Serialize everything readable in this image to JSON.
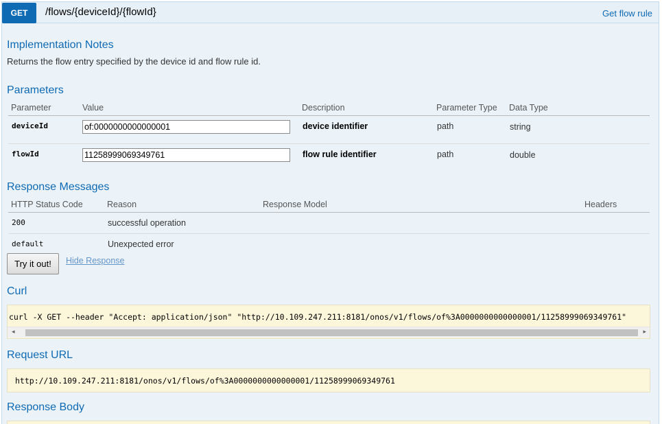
{
  "operation": {
    "method": "GET",
    "path": "/flows/{deviceId}/{flowId}",
    "summary": "Get flow rule"
  },
  "implementation_notes": {
    "title": "Implementation Notes",
    "text": "Returns the flow entry specified by the device id and flow rule id."
  },
  "parameters": {
    "title": "Parameters",
    "headers": [
      "Parameter",
      "Value",
      "Description",
      "Parameter Type",
      "Data Type"
    ],
    "rows": [
      {
        "name": "deviceId",
        "value": "of:0000000000000001",
        "description": "device identifier",
        "param_type": "path",
        "data_type": "string"
      },
      {
        "name": "flowId",
        "value": "11258999069349761",
        "description": "flow rule identifier",
        "param_type": "path",
        "data_type": "double"
      }
    ]
  },
  "response_messages": {
    "title": "Response Messages",
    "headers": [
      "HTTP Status Code",
      "Reason",
      "Response Model",
      "Headers"
    ],
    "rows": [
      {
        "code": "200",
        "reason": "successful operation"
      },
      {
        "code": "default",
        "reason": "Unexpected error"
      }
    ]
  },
  "actions": {
    "try_label": "Try it out!",
    "hide_label": "Hide Response"
  },
  "curl": {
    "title": "Curl",
    "command": "curl -X GET --header \"Accept: application/json\" \"http://10.109.247.211:8181/onos/v1/flows/of%3A0000000000000001/11258999069349761\""
  },
  "request_url": {
    "title": "Request URL",
    "url": "http://10.109.247.211:8181/onos/v1/flows/of%3A0000000000000001/11258999069349761"
  },
  "response_body": {
    "title": "Response Body"
  },
  "colors": {
    "accent": "#0f6ab4",
    "panel_bg": "#ebf3f9",
    "code_bg": "#fcf6db"
  },
  "icons": {
    "scroll_left": "◂",
    "scroll_right": "▸"
  }
}
